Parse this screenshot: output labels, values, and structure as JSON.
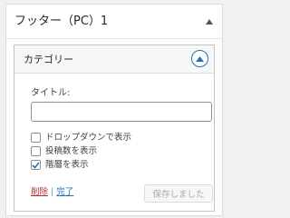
{
  "widget_area": {
    "title": "フッター（PC）1",
    "toggle_icon": "triangle-up-icon"
  },
  "widget": {
    "title": "カテゴリー",
    "toggle_icon": "chevron-up-icon",
    "title_field": {
      "label": "タイトル:",
      "value": ""
    },
    "options": [
      {
        "label": "ドロップダウンで表示",
        "checked": false
      },
      {
        "label": "投稿数を表示",
        "checked": false
      },
      {
        "label": "階層を表示",
        "checked": true
      }
    ],
    "links": {
      "delete": "削除",
      "separator": " | ",
      "done": "完了"
    },
    "save_button": "保存しました"
  },
  "colors": {
    "accent": "#2271b1",
    "delete": "#b32d2e",
    "border": "#c3c4c7"
  }
}
